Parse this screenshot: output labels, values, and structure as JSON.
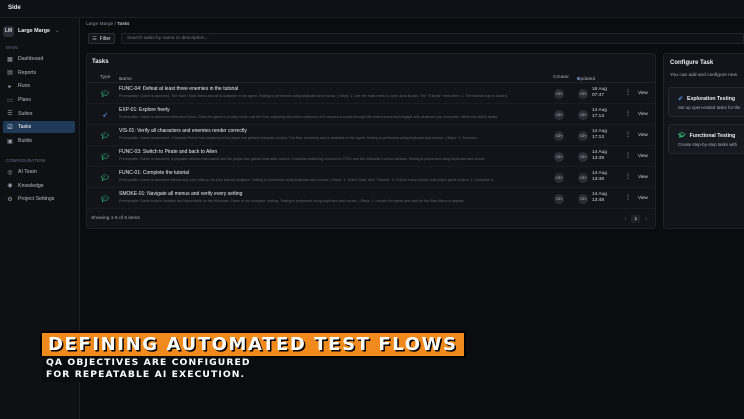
{
  "app": {
    "name": "Side"
  },
  "workspace": {
    "initials": "LM",
    "name": "Large Marge"
  },
  "sidebar": {
    "main_label": "MAIN",
    "main_items": [
      {
        "label": "Dashboard",
        "icon": "dashboard-icon"
      },
      {
        "label": "Reports",
        "icon": "reports-icon"
      },
      {
        "label": "Runs",
        "icon": "play-icon"
      },
      {
        "label": "Plans",
        "icon": "plans-icon"
      },
      {
        "label": "Suites",
        "icon": "suites-icon"
      },
      {
        "label": "Tasks",
        "icon": "tasks-icon",
        "active": true
      },
      {
        "label": "Builds",
        "icon": "builds-icon"
      }
    ],
    "config_label": "CONFIGURATION",
    "config_items": [
      {
        "label": "AI Team",
        "icon": "ai-team-icon"
      },
      {
        "label": "Knowledge",
        "icon": "knowledge-icon"
      },
      {
        "label": "Project Settings",
        "icon": "gear-icon"
      }
    ]
  },
  "breadcrumb": {
    "parent": "Large Marge",
    "separator": "/",
    "current": "Tasks"
  },
  "toolbar": {
    "filter_label": "Filter",
    "search_placeholder": "Search tasks by name or description..."
  },
  "tasks": {
    "title": "Tasks",
    "columns": {
      "type": "Type",
      "name": "Name",
      "creator": "Creator",
      "updated": "Updated"
    },
    "rows": [
      {
        "type": "functional",
        "title": "FUNC-04: Defeat at least three enemies in the tutorial",
        "desc": "Prerequisite: Game is launched. The Start / Main Menu and all is available in the agent. Testing is performed using keyboard and mouse. | Steps: 1. Use the main menu to open Java Books. The \"Tutorial\" menu item. 2. The tutorial map is loaded.",
        "creator": "CH",
        "updater": "CH",
        "date": "16 Aug",
        "time": "07:47",
        "view": "View"
      },
      {
        "type": "exploration",
        "title": "EXP-01: Explore freely",
        "desc": "Prerequisite: Game is launched Extended Demo. Once the game is in play mode, use the Run, exploring and visit a minimum of 5 minutes in mode through the environment and engage with whatever you encounter. When the skill is active.",
        "creator": "CH",
        "updater": "CH",
        "date": "14 Aug",
        "time": "17:13",
        "view": "View"
      },
      {
        "type": "functional",
        "title": "VIS-01: Verify all characters and enemies render correctly",
        "desc": "Prerequisite: Game is launched. Character Select has loaded and the player has gained character control. The flow, rendering and is available in the agent. Testing is performed using keyboard and mouse. | Steps: 1. Summon.",
        "creator": "CH",
        "updater": "CH",
        "date": "14 Aug",
        "time": "17:13",
        "view": "View"
      },
      {
        "type": "functional",
        "title": "FUNC-03: Switch to Pirate and back to Alien",
        "desc": "Prerequisite: Game is launched, a playable mission has loaded and the player has gained character control. Character switching is bound to CTRL and the character's select window. Testing is performed using keyboard and mouse.",
        "creator": "CH",
        "updater": "CH",
        "date": "14 Aug",
        "time": "13:49",
        "view": "View"
      },
      {
        "type": "functional",
        "title": "FUNC-01: Complete the tutorial",
        "desc": "Prerequisite: Game is launched without any save history. No prior tutorial progress. Testing is performed using keyboard and mouse. | Steps: 1. Select Start, then \"Tutorial.\" 2. Follow every prompt until player gains control. 3. Complete a.",
        "creator": "CH",
        "updater": "CH",
        "date": "14 Aug",
        "time": "13:48",
        "view": "View"
      },
      {
        "type": "functional",
        "title": "SMOKE-01: Navigate all menus and verify every setting",
        "desc": "Prerequisite: Game build is installed and launchable on the Windows. Game is run complete, testing. Testing is performed using keyboard and mouse. | Steps: 1. Launch the game and wait for the Start Menu to appear.",
        "creator": "CH",
        "updater": "CH",
        "date": "14 Aug",
        "time": "13:48",
        "view": "View"
      }
    ],
    "footer": "Showing 1-6 of 6 items",
    "page": "1"
  },
  "configure": {
    "title": "Configure Task",
    "subtitle": "You can add and configure new",
    "cards": [
      {
        "title": "Exploration Testing",
        "desc": "Set up open-ended tasks for the",
        "icon": "rocket-icon"
      },
      {
        "title": "Functional Testing",
        "desc": "Create step-by-step tasks with",
        "icon": "graduation-cap-icon"
      }
    ]
  },
  "caption": {
    "title": "DEFINING AUTOMATED TEST FLOWS",
    "line1": "QA OBJECTIVES ARE CONFIGURED",
    "line2": "FOR REPEATABLE AI EXECUTION."
  },
  "colors": {
    "accent_active": "#1e3a57",
    "caption_orange": "#f08a1c",
    "functional_icon": "#2ec27e",
    "exploration_icon": "#5aa2ff"
  }
}
